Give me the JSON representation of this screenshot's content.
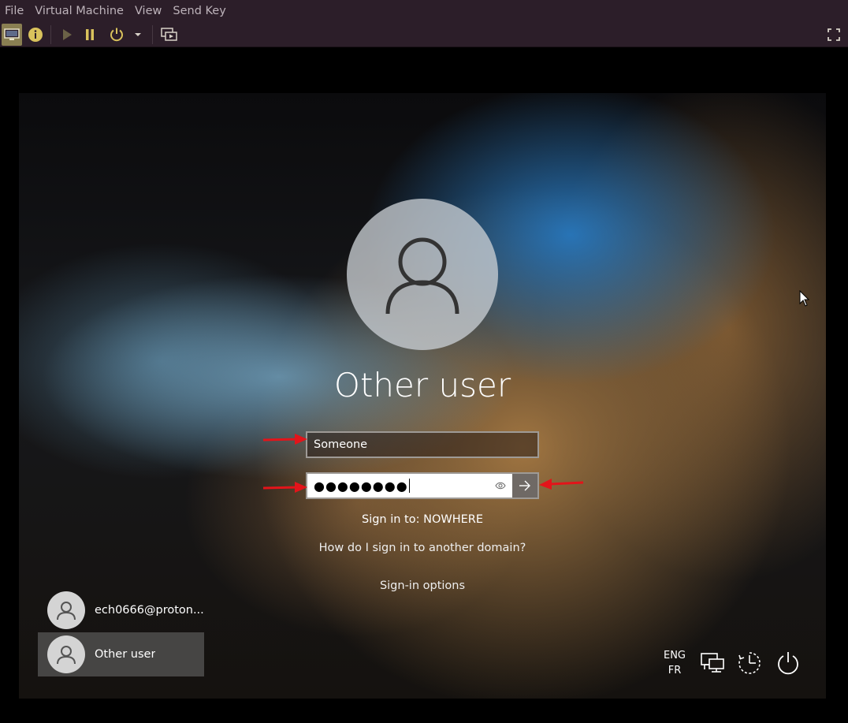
{
  "menubar": {
    "items": [
      "File",
      "Virtual Machine",
      "View",
      "Send Key"
    ]
  },
  "toolbar": {
    "buttons": [
      "display-icon",
      "info-icon",
      "play-icon",
      "pause-icon",
      "power-icon",
      "dropdown-arrow-icon",
      "screenshot-icon",
      "fullscreen-icon"
    ],
    "accent_color": "#d9c25c"
  },
  "login": {
    "title": "Other user",
    "username_value": "Someone",
    "password_mask": "●●●●●●●●",
    "signin_to": "Sign in to: NOWHERE",
    "domain_help": "How do I sign in to another domain?",
    "signin_options": "Sign-in options"
  },
  "users": [
    {
      "label": "ech0666@proton...",
      "selected": false
    },
    {
      "label": "Other user",
      "selected": true
    }
  ],
  "tray": {
    "lang_top": "ENG",
    "lang_bottom": "FR",
    "icons": [
      "network-icon",
      "ease-of-access-icon",
      "power-icon"
    ]
  },
  "annotation_color": "#e3141a"
}
